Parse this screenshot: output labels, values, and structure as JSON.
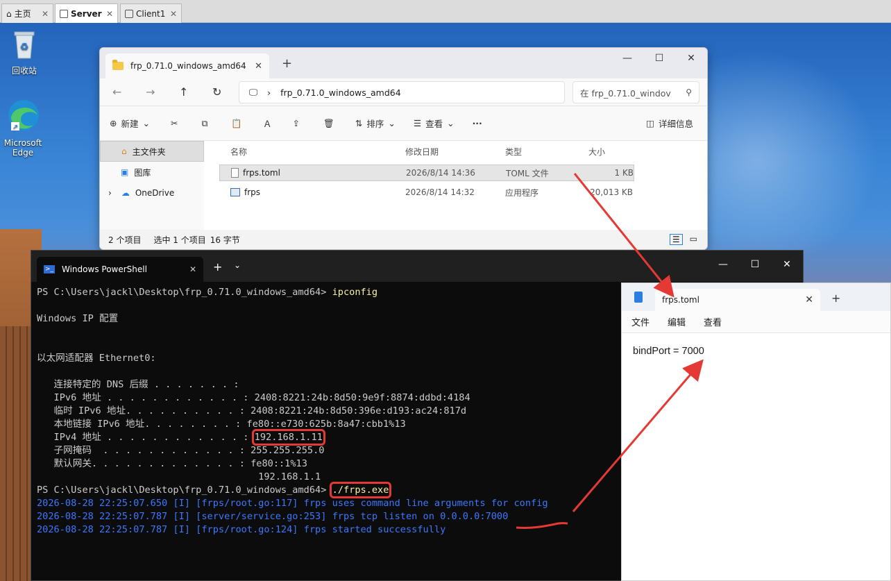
{
  "host": {
    "tabs": [
      {
        "label": "主页",
        "icon": "home-icon"
      },
      {
        "label": "Server",
        "icon": "vm-icon"
      },
      {
        "label": "Client1",
        "icon": "vm-icon"
      }
    ]
  },
  "desktop": {
    "icons": [
      {
        "label": "回收站",
        "icon": "recycle-bin-icon"
      },
      {
        "label": "Microsoft Edge",
        "icon": "edge-icon"
      }
    ]
  },
  "explorer": {
    "tab_title": "frp_0.71.0_windows_amd64",
    "address": "frp_0.71.0_windows_amd64",
    "search_placeholder": "在 frp_0.71.0_windov",
    "commands": {
      "new": "新建",
      "sort": "排序",
      "view": "查看",
      "details": "详细信息"
    },
    "nav": [
      {
        "label": "主文件夹"
      },
      {
        "label": "图库"
      },
      {
        "label": "OneDrive"
      }
    ],
    "columns": {
      "name": "名称",
      "modified": "修改日期",
      "type": "类型",
      "size": "大小"
    },
    "files": [
      {
        "name": "frps.toml",
        "modified": "2026/8/14 14:36",
        "type": "TOML 文件",
        "size": "1 KB",
        "selected": true
      },
      {
        "name": "frps",
        "modified": "2026/8/14 14:32",
        "type": "应用程序",
        "size": "20,013 KB",
        "selected": false
      }
    ],
    "status": {
      "count": "2 个项目",
      "selection": "选中 1 个项目",
      "bytes": "16 字节"
    }
  },
  "powershell": {
    "tab_title": "Windows PowerShell",
    "prompt": "PS C:\\Users\\jackl\\Desktop\\frp_0.71.0_windows_amd64> ",
    "cmd1": "ipconfig",
    "l_winip": "Windows IP 配置",
    "l_adapter": "以太网适配器 Ethernet0:",
    "l_dns": "   连接特定的 DNS 后缀 . . . . . . . : ",
    "l_ipv6": "   IPv6 地址 . . . . . . . . . . . . : 2408:8221:24b:8d50:9e9f:8874:ddbd:4184",
    "l_tmpv6": "   临时 IPv6 地址. . . . . . . . . . : 2408:8221:24b:8d50:396e:d193:ac24:817d",
    "l_link": "   本地链接 IPv6 地址. . . . . . . . : fe80::e730:625b:8a47:cbb1%13",
    "l_ipv4_label": "   IPv4 地址 . . . . . . . . . . . . : ",
    "ipv4": "192.168.1.11",
    "l_mask": "   子网掩码  . . . . . . . . . . . . : 255.255.255.0",
    "l_gw": "   默认网关. . . . . . . . . . . . . : fe80::1%13",
    "l_gw2": "                                       192.168.1.1",
    "cmd2": "./frps.exe",
    "log1": "2026-08-28 22:25:07.650 [I] [frps/root.go:117] frps uses command line arguments for config",
    "log2": "2026-08-28 22:25:07.787 [I] [server/service.go:253] frps tcp listen on 0.0.0.0:7000",
    "log3": "2026-08-28 22:25:07.787 [I] [frps/root.go:124] frps started successfully"
  },
  "notepad": {
    "tab_title": "frps.toml",
    "menu": {
      "file": "文件",
      "edit": "编辑",
      "view": "查看"
    },
    "content": "bindPort = 7000"
  },
  "annotation_color": "#e53935"
}
